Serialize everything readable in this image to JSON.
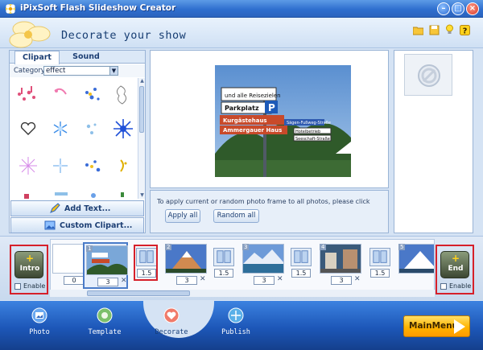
{
  "window": {
    "title": "iPixSoft Flash Slideshow Creator"
  },
  "header": {
    "title": "Decorate your show"
  },
  "left_panel": {
    "tabs": [
      "Clipart",
      "Sound"
    ],
    "category_label": "Category",
    "category_value": "effect",
    "add_text_label": "Add Text...",
    "custom_clipart_label": "Custom Clipart..."
  },
  "photo_frame": {
    "apply_hint": "To apply current or random photo frame to all photos, please click",
    "apply_all_label": "Apply all",
    "random_all_label": "Random all"
  },
  "timeline": {
    "intro": {
      "label": "Intro",
      "enable_label": "Enable"
    },
    "end": {
      "label": "End",
      "enable_label": "Enable"
    },
    "start_duration": "0",
    "slides": [
      {
        "number": "1",
        "duration": "3"
      },
      {
        "number": "2",
        "duration": "3"
      },
      {
        "number": "3",
        "duration": "3"
      },
      {
        "number": "4",
        "duration": "3"
      },
      {
        "number": "5",
        "duration": ""
      }
    ],
    "transitions": [
      "1.5",
      "1.5",
      "1.5",
      "1.5"
    ]
  },
  "nav": {
    "items": [
      "Photo",
      "Template",
      "Decorate",
      "Publish"
    ],
    "active": "Decorate"
  },
  "main_menu_label": "MainMenu",
  "signs": {
    "info": "und alle Reisezielen",
    "parkplatz": "Parkplatz",
    "p": "P",
    "kurgast": "Kurgästehaus",
    "ammergauer": "Ammergauer Haus",
    "sign1": "Sägen-Fußweg-Straße",
    "sign2": "Hotelbetrieb",
    "sign3": "Seeschaft-Straße"
  },
  "colors": {
    "highlight": "#d6202a",
    "accent": "#1d57b8",
    "menu": "#ffb400"
  }
}
